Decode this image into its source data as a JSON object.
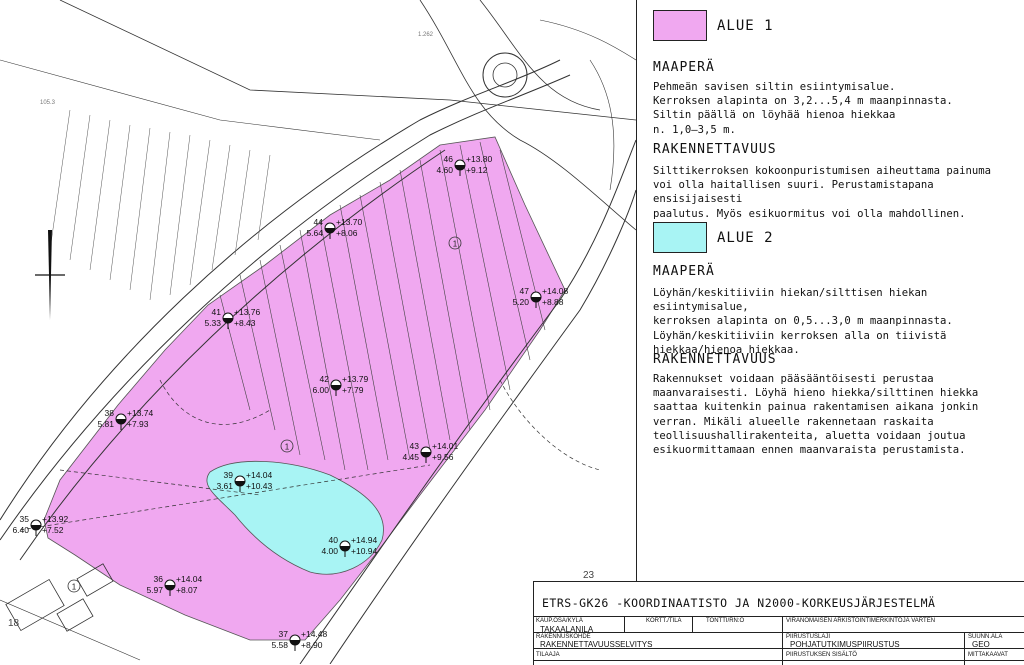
{
  "legend": {
    "alue1": {
      "label": "ALUE 1",
      "color": "#f0a8f0",
      "maapera_heading": "MAAPERÄ",
      "maapera_text": "Pehmeän savisen siltin esiintymisalue.\nKerroksen alapinta on 3,2...5,4 m maanpinnasta.\nSiltin päällä on löyhää hienoa hiekkaa\nn. 1,0–3,5 m.",
      "rak_heading": "RAKENNETTAVUUS",
      "rak_text": "Silttikerroksen kokoonpuristumisen aiheuttama painuma\nvoi olla haitallisen suuri. Perustamistapana ensisijaisesti\npaalutus. Myös esikuormitus voi olla mahdollinen."
    },
    "alue2": {
      "label": "ALUE 2",
      "color": "#a8f4f4",
      "maapera_heading": "MAAPERÄ",
      "maapera_text": "Löyhän/keskitiiviin hiekan/silttisen hiekan esiintymisalue,\nkerroksen alapinta on 0,5...3,0 m maanpinnasta.\nLöyhän/keskitiiviin kerroksen alla on tiivistä\nhiekkaa/hienoa hiekkaa.",
      "rak_heading": "RAKENNETTAVUUS",
      "rak_text": "Rakennukset voidaan pääsääntöisesti perustaa\nmaanvaraisesti. Löyhä hieno hiekka/silttinen hiekka\nsaattaa kuitenkin painua rakentamisen aikana jonkin\nverran. Mikäli alueelle rakennetaan raskaita\nteollisuushallirakenteita, aluetta voidaan joutua\nesikuormittamaan ennen maanvaraista perustamista."
    }
  },
  "title_block": {
    "coordinate_system": "ETRS-GK26 -KOORDINAATISTO JA N2000-KORKEUSJÄRJESTELMÄ",
    "kaup_osakyla_label": "KAUP.OSA/KYLÄ",
    "kaup_osakyla_value": "TAKAALANILA",
    "kortt_tila_label": "KORTT./TILA",
    "tontti_rn_label": "TONTTI/RN:O",
    "viranomainen_label": "VIRANOMAISEN ARKISTOINTIMERKINTÖJÄ VARTEN",
    "rakennuskohde_label": "RAKENNUSKOHDE",
    "rakennuskohde_value": "RAKENNETTAVUUSSELVITYS",
    "piirustuslaji_label": "PIIRUSTUSLAJI",
    "piirustuslaji_value": "POHJATUTKIMUSPIIRUSTUS",
    "suunn_ala_label": "SUUNN.ALA",
    "suunn_ala_value": "GEO",
    "tilaaja_label": "TILAAJA",
    "piirustuksen_sisalto_label": "PIIRUSTUKSEN SISÄLTÖ",
    "mittakaavat_label": "MITTAKAAVAT"
  },
  "map": {
    "area_markers": [
      "1",
      "1",
      "1"
    ],
    "map_numbers": [
      "1.262",
      "105.3",
      "23",
      "18"
    ],
    "boreholes": [
      {
        "id": "46",
        "depth": "4.60",
        "top": "+13.80",
        "bottom": "+9.12"
      },
      {
        "id": "44",
        "depth": "5.64",
        "top": "+13.70",
        "bottom": "+8.06"
      },
      {
        "id": "47",
        "depth": "5.20",
        "top": "+14.08",
        "bottom": "+8.88"
      },
      {
        "id": "41",
        "depth": "5.33",
        "top": "+13.76",
        "bottom": "+8.43"
      },
      {
        "id": "42",
        "depth": "6.00",
        "top": "+13.79",
        "bottom": "+7.79"
      },
      {
        "id": "38",
        "depth": "5.81",
        "top": "+13.74",
        "bottom": "+7.93"
      },
      {
        "id": "43",
        "depth": "4.45",
        "top": "+14.01",
        "bottom": "+9.56"
      },
      {
        "id": "39",
        "depth": "3.61",
        "top": "+14.04",
        "bottom": "+10.43"
      },
      {
        "id": "35",
        "depth": "6.40",
        "top": "+13.92",
        "bottom": "+7.52"
      },
      {
        "id": "40",
        "depth": "4.00",
        "top": "+14.94",
        "bottom": "+10.94"
      },
      {
        "id": "36",
        "depth": "5.97",
        "top": "+14.04",
        "bottom": "+8.07"
      },
      {
        "id": "37",
        "depth": "5.58",
        "top": "+14.48",
        "bottom": "+8.90"
      }
    ]
  }
}
